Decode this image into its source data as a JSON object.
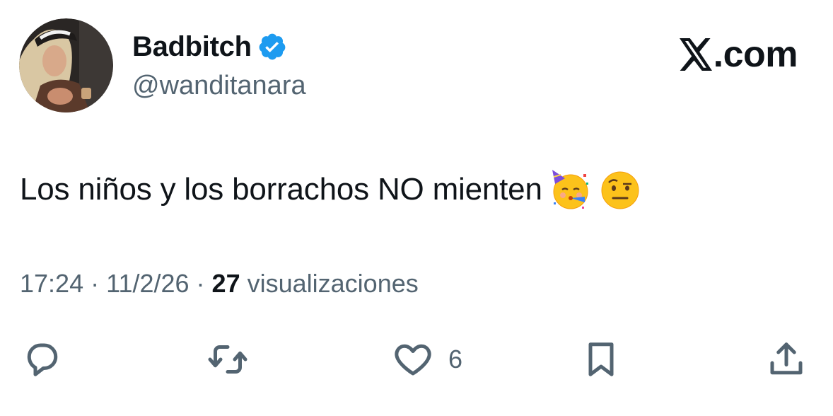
{
  "author": {
    "display_name": "Badbitch",
    "handle": "@wanditanara",
    "verified": true,
    "avatar_icon": "profile-photo"
  },
  "brand": {
    "text": ".com",
    "logo_icon": "x-logo-icon"
  },
  "tweet": {
    "text": "Los niños y los borrachos NO mienten",
    "emojis": [
      "partying-face-emoji",
      "face-with-raised-eyebrow-emoji"
    ]
  },
  "meta": {
    "time": "17:24",
    "separator": " · ",
    "date": "11/2/26",
    "views_count": "27",
    "views_label": "visualizaciones"
  },
  "actions": {
    "reply_icon": "reply-icon",
    "retweet_icon": "retweet-icon",
    "like_icon": "heart-icon",
    "like_count": "6",
    "bookmark_icon": "bookmark-icon",
    "share_icon": "share-icon"
  },
  "colors": {
    "text_primary": "#0f1419",
    "text_secondary": "#536471",
    "verified_blue": "#1d9bf0",
    "background": "#ffffff"
  }
}
